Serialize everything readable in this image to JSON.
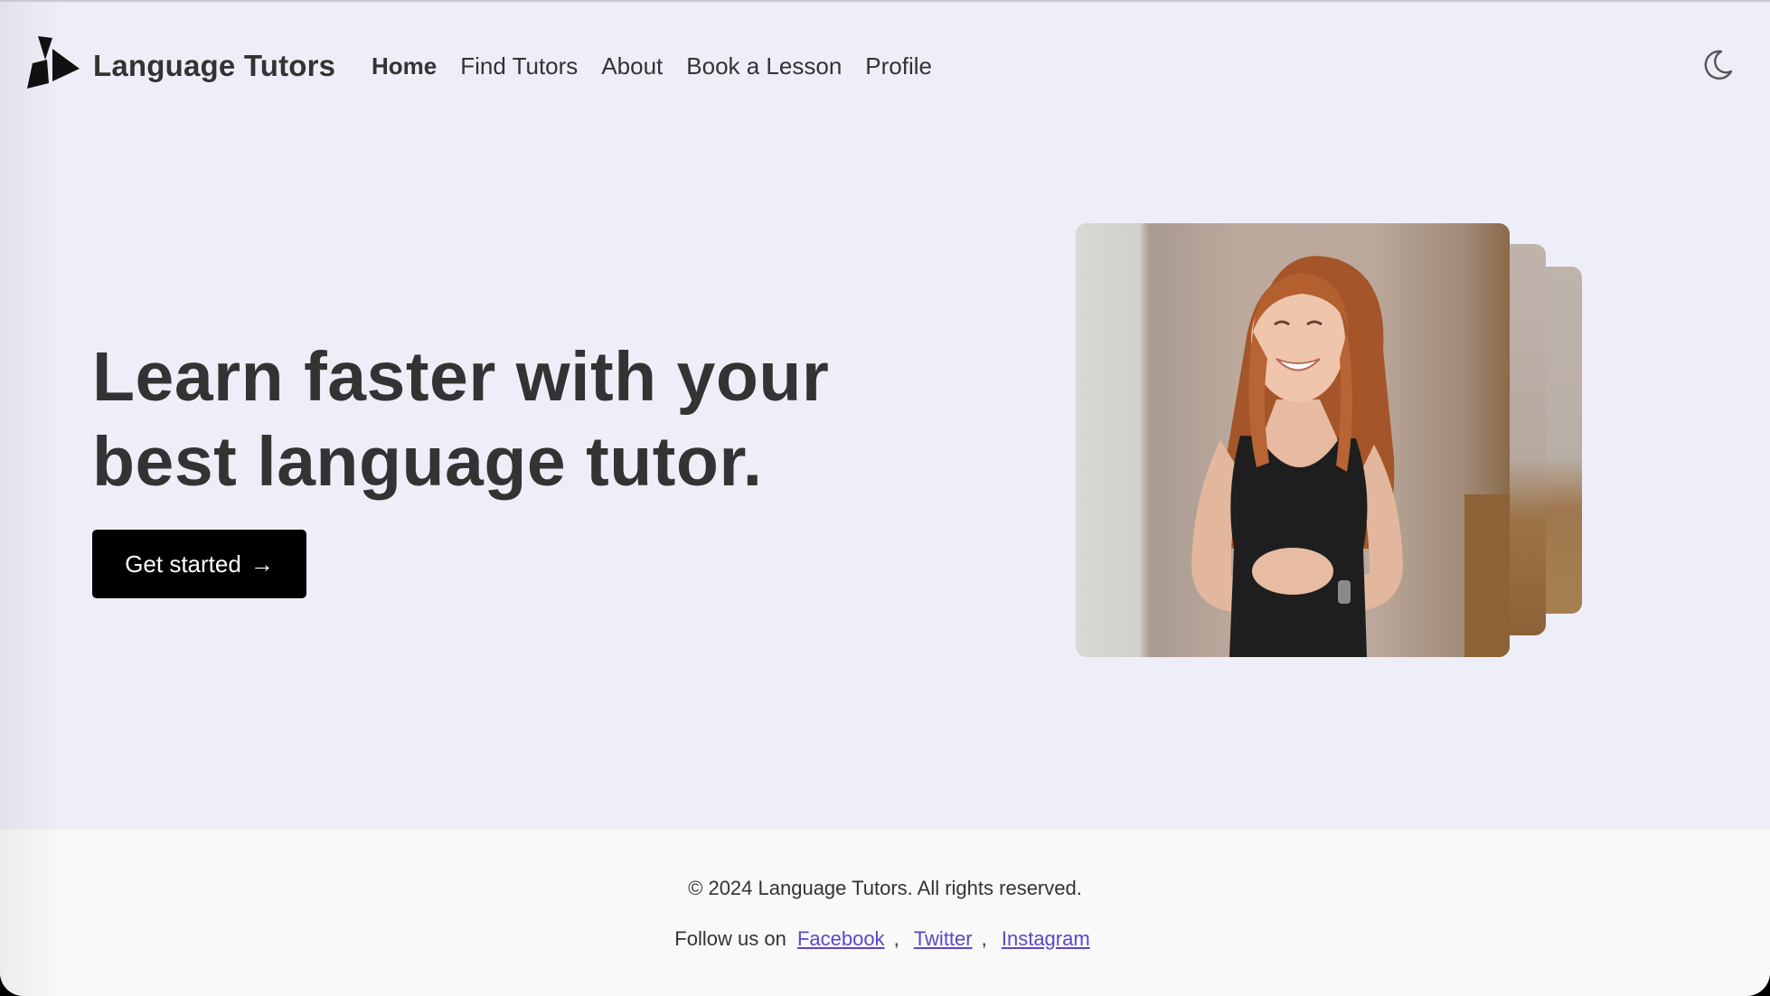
{
  "brand": {
    "name": "Language Tutors",
    "logo_icon": "triangles-logo-icon"
  },
  "nav": {
    "items": [
      {
        "label": "Home",
        "active": true
      },
      {
        "label": "Find Tutors",
        "active": false
      },
      {
        "label": "About",
        "active": false
      },
      {
        "label": "Book a Lesson",
        "active": false
      },
      {
        "label": "Profile",
        "active": false
      }
    ],
    "theme_toggle_icon": "moon-icon"
  },
  "hero": {
    "title_line1": "Learn faster with your",
    "title_line2": "best language tutor.",
    "cta_label": "Get started",
    "cta_arrow": "→"
  },
  "footer": {
    "copyright": "© 2024 Language Tutors. All rights reserved.",
    "follow_prefix": "Follow us on",
    "separator": ",",
    "links": [
      "Facebook",
      "Twitter",
      "Instagram"
    ]
  },
  "colors": {
    "background": "#eeeef8",
    "footer_background": "#f9f9f9",
    "text": "#333333",
    "link": "#5a48c8",
    "cta_background": "#000000"
  }
}
